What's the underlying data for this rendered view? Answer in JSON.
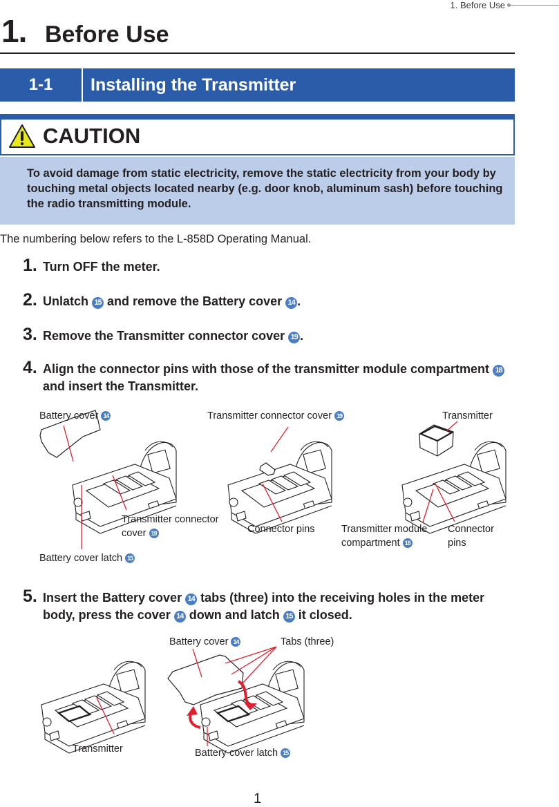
{
  "running_header": "1.  Before Use",
  "chapter": {
    "number": "1.",
    "title": "Before Use"
  },
  "section": {
    "number": "1-1",
    "title": "Installing the Transmitter"
  },
  "caution": {
    "icon": "warning-triangle-icon",
    "label": "CAUTION",
    "text": "To avoid damage from static electricity, remove the static electricity from your body by touching metal objects located nearby (e.g. door knob, aluminum sash) before touching the radio transmitting module."
  },
  "intro": "The numbering below refers to the L-858D Operating Manual.",
  "steps": [
    {
      "num": "1.",
      "parts": [
        "Turn OFF the meter."
      ]
    },
    {
      "num": "2.",
      "parts": [
        "Unlatch ",
        "15",
        " and remove the Battery cover ",
        "14",
        "."
      ]
    },
    {
      "num": "3.",
      "parts": [
        "Remove the Transmitter connector cover ",
        "19",
        "."
      ]
    },
    {
      "num": "4.",
      "parts": [
        "Align the connector pins with those of the transmitter module compartment ",
        "18",
        " and insert the Transmitter."
      ]
    },
    {
      "num": "5.",
      "parts": [
        "Insert the Battery cover ",
        "14",
        " tabs (three) into the receiving holes in the meter body, press the cover ",
        "14",
        " down and latch ",
        "15",
        " it closed."
      ]
    }
  ],
  "figure1": {
    "labels": {
      "battery_cover": "Battery cover",
      "battery_cover_num": "14",
      "tcc_line1": "Transmitter connector",
      "tcc_line2": "cover",
      "tcc_num": "19",
      "latch": "Battery cover latch",
      "latch_num": "15",
      "tcc_top": "Transmitter connector cover",
      "tcc_top_num": "19",
      "connector_pins": "Connector pins",
      "transmitter": "Transmitter",
      "tmc_line1": "Transmitter module",
      "tmc_line2": "compartment",
      "tmc_num": "18",
      "cp_line1": "Connector",
      "cp_line2": "pins"
    }
  },
  "figure2": {
    "labels": {
      "battery_cover": "Battery cover",
      "battery_cover_num": "14",
      "tabs": "Tabs (three)",
      "transmitter": "Transmitter",
      "latch": "Battery cover latch",
      "latch_num": "15"
    }
  },
  "colors": {
    "section_blue": "#2a5caa",
    "caution_bg": "#bccde9",
    "badge_blue": "#4a7ec4",
    "leader_red": "#e0202e"
  },
  "page_number": "1"
}
